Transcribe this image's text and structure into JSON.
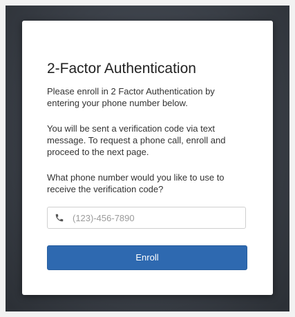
{
  "dialog": {
    "title": "2-Factor Authentication",
    "intro": "Please enroll in 2 Factor Authentication by entering your phone number below.",
    "info": "You will be sent a verification code via text message. To request a phone call, enroll and proceed to the next page.",
    "question": "What phone number would you like to use to receive the verification code?",
    "phone_field": {
      "placeholder": "(123)-456-7890",
      "value": "",
      "icon": "phone-icon"
    },
    "enroll_label": "Enroll"
  },
  "colors": {
    "backdrop": "#3a3f47",
    "button": "#2e69b0",
    "button_text": "#ffffff",
    "card": "#ffffff"
  }
}
